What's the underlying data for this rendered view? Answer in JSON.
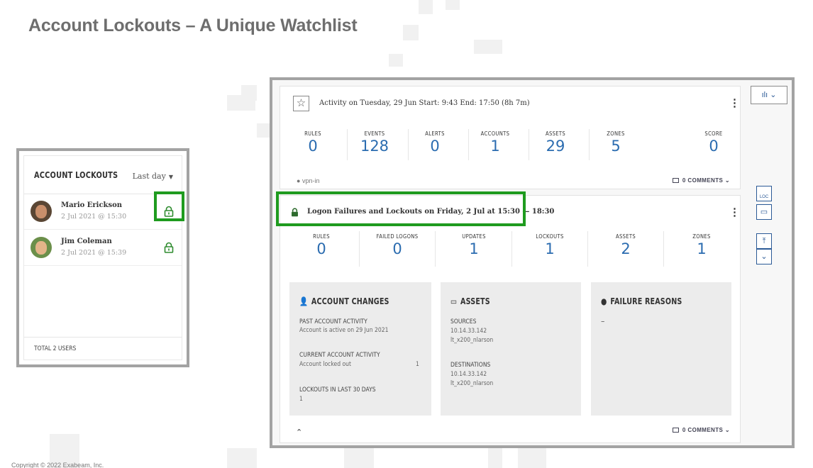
{
  "slide": {
    "title": "Account Lockouts – A Unique Watchlist",
    "copyright": "Copyright © 2022 Exabeam, Inc."
  },
  "lockouts_panel": {
    "title": "ACCOUNT LOCKOUTS",
    "range": "Last day",
    "users": [
      {
        "name": "Mario Erickson",
        "date": "2 Jul 2021 @ 15:30"
      },
      {
        "name": "Jim Coleman",
        "date": "2 Jul 2021 @ 15:39"
      }
    ],
    "footer": "TOTAL 2 USERS"
  },
  "activity_card": {
    "title": "Activity on Tuesday, 29 Jun   Start: 9:43 End: 17:50 (8h 7m)",
    "stats": [
      {
        "label": "RULES",
        "value": "0"
      },
      {
        "label": "EVENTS",
        "value": "128"
      },
      {
        "label": "ALERTS",
        "value": "0"
      },
      {
        "label": "ACCOUNTS",
        "value": "1"
      },
      {
        "label": "ASSETS",
        "value": "29"
      },
      {
        "label": "ZONES",
        "value": "5"
      },
      {
        "label": "SCORE",
        "value": "0"
      }
    ],
    "tag": "vpn-in",
    "comments": "0 COMMENTS"
  },
  "logon_card": {
    "title": "Logon Failures and Lockouts on Friday, 2 Jul at 15:30 — 18:30",
    "stats": [
      {
        "label": "RULES",
        "value": "0"
      },
      {
        "label": "FAILED LOGONS",
        "value": "0"
      },
      {
        "label": "UPDATES",
        "value": "1"
      },
      {
        "label": "LOCKOUTS",
        "value": "1"
      },
      {
        "label": "ASSETS",
        "value": "2"
      },
      {
        "label": "ZONES",
        "value": "1"
      }
    ],
    "account_changes": {
      "heading": "ACCOUNT CHANGES",
      "past_label": "PAST ACCOUNT ACTIVITY",
      "past_value": "Account is active on 29 Jun 2021",
      "current_label": "CURRENT ACCOUNT ACTIVITY",
      "current_value": "Account locked out",
      "current_count": "1",
      "lockouts_label": "LOCKOUTS IN LAST 30 DAYS",
      "lockouts_value": "1"
    },
    "assets": {
      "heading": "ASSETS",
      "sources_label": "SOURCES",
      "sources_ip": "10.14.33.142",
      "sources_host": "lt_x200_nlarson",
      "destinations_label": "DESTINATIONS",
      "destinations_ip": "10.14.33.142",
      "destinations_host": "lt_x200_nlarson"
    },
    "failure_reasons": {
      "heading": "FAILURE REASONS",
      "value": "–"
    },
    "comments": "0 COMMENTS"
  },
  "toolbar": {
    "chart_label": "ılı ⌄",
    "loc_label": "LOC"
  },
  "colors": {
    "highlight": "#1f9b1f",
    "value_blue": "#2b6cb0",
    "lock_green": "#2e8b2e"
  },
  "icons": [
    "star-icon",
    "kebab-menu-icon",
    "tag-icon",
    "comment-icon",
    "lock-icon",
    "user-icon",
    "monitor-icon",
    "info-icon",
    "chart-icon",
    "calendar-icon",
    "chevron-up-icon"
  ]
}
